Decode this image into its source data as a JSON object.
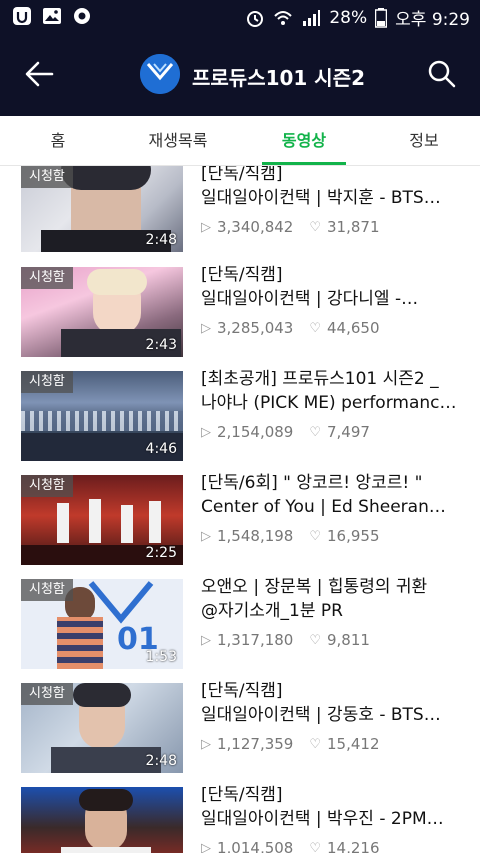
{
  "status_bar": {
    "battery_percent": "28%",
    "time": "오후 9:29"
  },
  "header": {
    "channel_title": "프로듀스101 시즌2",
    "logo_text": "101"
  },
  "tabs": [
    {
      "label": "홈"
    },
    {
      "label": "재생목록"
    },
    {
      "label": "동영상"
    },
    {
      "label": "정보"
    }
  ],
  "badge_label": "시청함",
  "videos": [
    {
      "title1": "[단독/직캠]",
      "title2": "일대일아이컨택 | 박지훈 - BTS…",
      "duration": "2:48",
      "views": "3,340,842",
      "likes": "31,871",
      "watched": true
    },
    {
      "title1": "[단독/직캠]",
      "title2": "일대일아이컨택 | 강다니엘 -…",
      "duration": "2:43",
      "views": "3,285,043",
      "likes": "44,650",
      "watched": true
    },
    {
      "title1": "[최초공개] 프로듀스101 시즌2 _",
      "title2": "나야나 (PICK ME) performanc…",
      "duration": "4:46",
      "views": "2,154,089",
      "likes": "7,497",
      "watched": true
    },
    {
      "title1": "[단독/6회]  \" 앙코르! 앙코르! \"",
      "title2": "Center of You | Ed Sheeran…",
      "duration": "2:25",
      "views": "1,548,198",
      "likes": "16,955",
      "watched": true
    },
    {
      "title1": "오앤오 | 장문복 | 힙통령의 귀환",
      "title2": "@자기소개_1분 PR",
      "duration": "1:53",
      "views": "1,317,180",
      "likes": "9,811",
      "watched": true
    },
    {
      "title1": "[단독/직캠]",
      "title2": "일대일아이컨택 | 강동호 - BTS…",
      "duration": "2:48",
      "views": "1,127,359",
      "likes": "15,412",
      "watched": true
    },
    {
      "title1": "[단독/직캠]",
      "title2": "일대일아이컨택 | 박우진 - 2PM…",
      "duration": "",
      "views": "1,014,508",
      "likes": "14,216",
      "watched": false
    }
  ],
  "colors": {
    "header_bg": "#0e1127",
    "accent": "#12b34a"
  }
}
